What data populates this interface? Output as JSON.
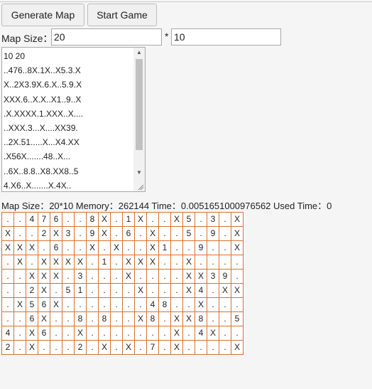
{
  "toolbar": {
    "generate_label": "Generate Map",
    "start_label": "Start Game"
  },
  "map_size": {
    "label": "Map Size：",
    "separator": "*",
    "width_value": "20",
    "height_value": "10"
  },
  "textarea": {
    "lines": [
      "10 20",
      "..476..8X.1X..X5.3.X",
      "X..2X3.9X.6.X..5.9.X",
      "XXX.6..X.X..X1..9..X",
      ".X.XXXX.1.XXX..X....",
      "..XXX.3...X....XX39.",
      "..2X.51.....X...X4.XX",
      ".X56X.......48..X...",
      "..6X..8.8..X8.XX8..5",
      "4.X6..X.......X.4X.."
    ]
  },
  "status": {
    "text": "Map Size：20*10 Memory：262144 Time：0.0051651000976562 Used Time：0"
  },
  "grid": [
    [
      ".",
      ".",
      "4",
      "7",
      "6",
      ".",
      ".",
      "8",
      "X",
      ".",
      "1",
      "X",
      ".",
      ".",
      "X",
      "5",
      ".",
      "3",
      ".",
      "X"
    ],
    [
      "X",
      ".",
      ".",
      "2",
      "X",
      "3",
      ".",
      "9",
      "X",
      ".",
      "6",
      ".",
      "X",
      ".",
      ".",
      "5",
      ".",
      "9",
      ".",
      "X"
    ],
    [
      "X",
      "X",
      "X",
      ".",
      "6",
      ".",
      ".",
      "X",
      ".",
      "X",
      ".",
      ".",
      "X",
      "1",
      ".",
      ".",
      "9",
      ".",
      ".",
      "X"
    ],
    [
      ".",
      "X",
      ".",
      "X",
      "X",
      "X",
      "X",
      ".",
      "1",
      ".",
      "X",
      "X",
      "X",
      ".",
      ".",
      "X",
      ".",
      ".",
      ".",
      "."
    ],
    [
      ".",
      ".",
      "X",
      "X",
      "X",
      ".",
      "3",
      ".",
      ".",
      ".",
      "X",
      ".",
      ".",
      ".",
      ".",
      "X",
      "X",
      "3",
      "9",
      "."
    ],
    [
      ".",
      ".",
      "2",
      "X",
      ".",
      "5",
      "1",
      ".",
      ".",
      ".",
      ".",
      "X",
      ".",
      ".",
      ".",
      "X",
      "4",
      ".",
      "X",
      "X"
    ],
    [
      ".",
      "X",
      "5",
      "6",
      "X",
      ".",
      ".",
      ".",
      ".",
      ".",
      ".",
      ".",
      "4",
      "8",
      ".",
      ".",
      "X",
      ".",
      ".",
      "."
    ],
    [
      ".",
      ".",
      "6",
      "X",
      ".",
      ".",
      "8",
      ".",
      "8",
      ".",
      ".",
      "X",
      "8",
      ".",
      "X",
      "X",
      "8",
      ".",
      ".",
      "5"
    ],
    [
      "4",
      ".",
      "X",
      "6",
      ".",
      ".",
      "X",
      ".",
      ".",
      ".",
      ".",
      ".",
      ".",
      ".",
      "X",
      ".",
      "4",
      "X",
      ".",
      "."
    ],
    [
      "2",
      ".",
      "X",
      ".",
      ".",
      ".",
      "2",
      ".",
      "X",
      ".",
      "X",
      ".",
      "7",
      ".",
      "X",
      ".",
      ".",
      ".",
      ".",
      "X"
    ]
  ],
  "colors": {
    "grid_border": "#d9712f",
    "background": "#f5f5f5"
  },
  "icons": {
    "scroll_up": "triangle-up-icon",
    "scroll_down": "triangle-down-icon",
    "resize": "resize-grip-icon"
  }
}
